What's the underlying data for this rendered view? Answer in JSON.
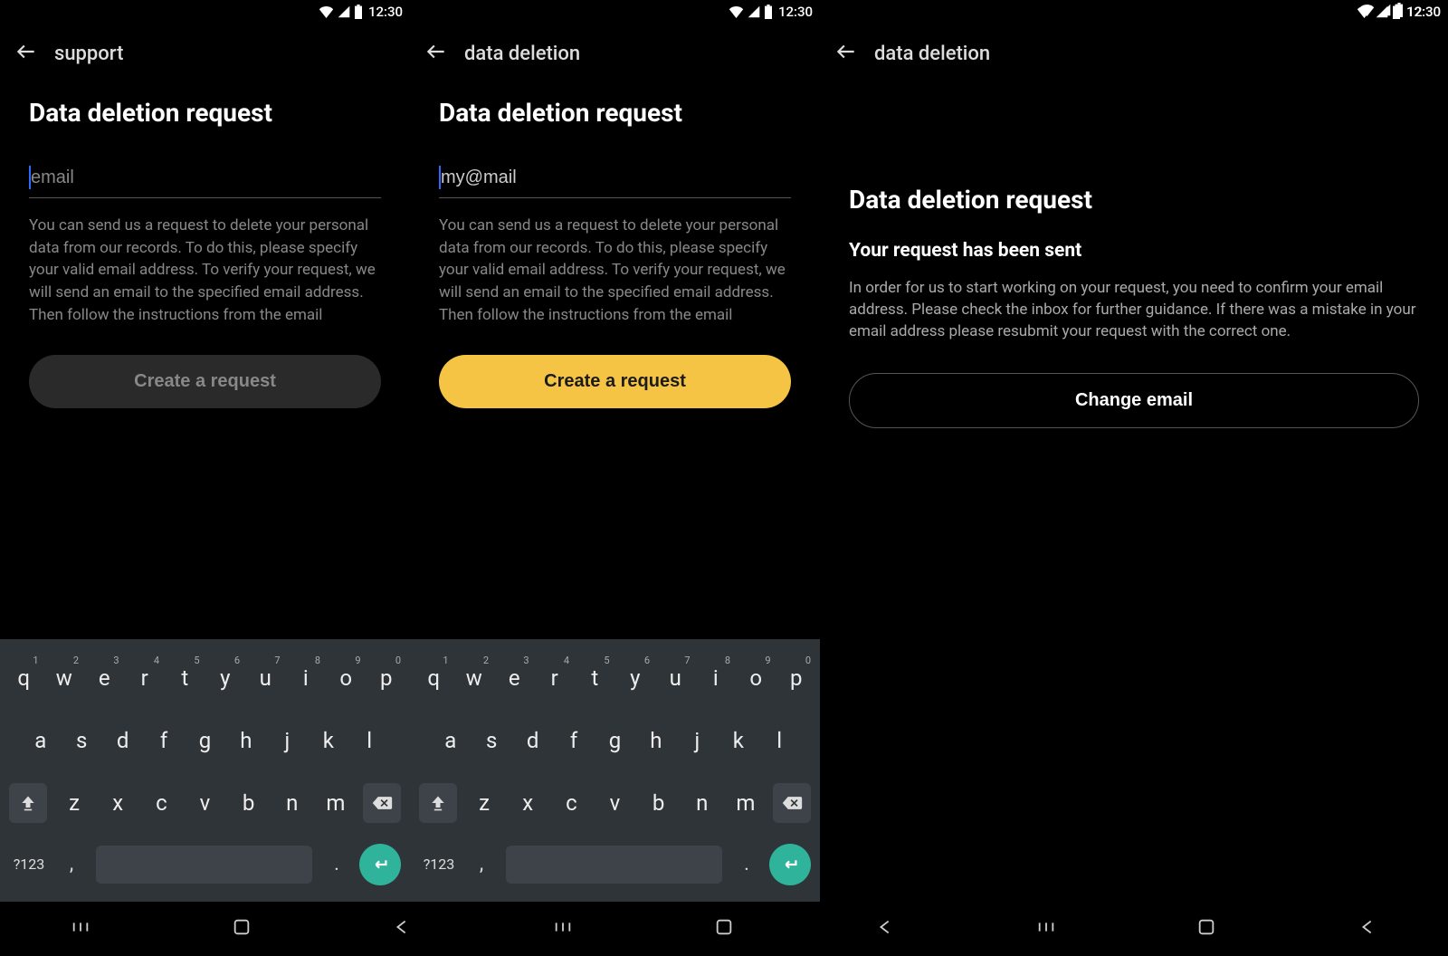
{
  "status": {
    "time": "12:30"
  },
  "screens": [
    {
      "appbar_title": "support",
      "heading": "Data deletion request",
      "email_placeholder": "email",
      "email_value": "",
      "helper_text": "You can send us a request to delete your personal data from our records. To do this, please specify your valid email address. To verify your request, we will send an email to the specified email address. Then follow the instructions from the email",
      "button_label": "Create a request",
      "button_state": "disabled"
    },
    {
      "appbar_title": "data deletion",
      "heading": "Data deletion request",
      "email_placeholder": "",
      "email_value": "my@mail",
      "helper_text": "You can send us a request to delete your personal data from our records. To do this, please specify your valid email address. To verify your request, we will send an email to the specified email address. Then follow the instructions from the email",
      "button_label": "Create a request",
      "button_state": "primary"
    },
    {
      "appbar_title": "data deletion",
      "heading": "Data deletion request",
      "subheading": "Your request has been sent",
      "body": "In order for us to start working on your request, you need to confirm your email address. Please check the inbox for further guidance.\nIf there was a mistake in your email address please resubmit your request with the correct one.",
      "button_label": "Change email",
      "button_state": "outline"
    }
  ],
  "keyboard": {
    "row1": [
      {
        "k": "q",
        "n": "1"
      },
      {
        "k": "w",
        "n": "2"
      },
      {
        "k": "e",
        "n": "3"
      },
      {
        "k": "r",
        "n": "4"
      },
      {
        "k": "t",
        "n": "5"
      },
      {
        "k": "y",
        "n": "6"
      },
      {
        "k": "u",
        "n": "7"
      },
      {
        "k": "i",
        "n": "8"
      },
      {
        "k": "o",
        "n": "9"
      },
      {
        "k": "p",
        "n": "0"
      }
    ],
    "row2": [
      "a",
      "s",
      "d",
      "f",
      "g",
      "h",
      "j",
      "k",
      "l"
    ],
    "row3": [
      "z",
      "x",
      "c",
      "v",
      "b",
      "n",
      "m"
    ],
    "sym_label": "?123",
    "comma": ",",
    "period": "."
  }
}
